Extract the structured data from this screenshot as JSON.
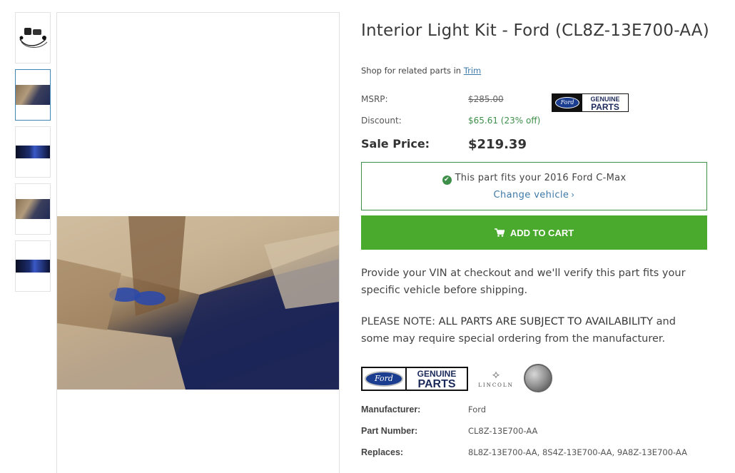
{
  "gallery": {
    "thumbnails": [
      {
        "name": "thumb-light-kit",
        "active": false
      },
      {
        "name": "thumb-interior-day",
        "active": true
      },
      {
        "name": "thumb-interior-night",
        "active": false
      },
      {
        "name": "thumb-interior-day-2",
        "active": false
      },
      {
        "name": "thumb-interior-night-2",
        "active": false
      }
    ]
  },
  "product": {
    "title": "Interior Light Kit - Ford (CL8Z-13E700-AA)",
    "related_prefix": "Shop for related parts in",
    "related_link": "Trim"
  },
  "pricing": {
    "msrp_label": "MSRP:",
    "msrp_value": "$285.00",
    "discount_label": "Discount:",
    "discount_value": "$65.61 (23% off)",
    "sale_label": "Sale Price:",
    "sale_value": "$219.39"
  },
  "badge": {
    "ford": "Ford",
    "genuine": "GENUINE",
    "parts": "PARTS"
  },
  "fitment": {
    "message": "This part fits your 2016 Ford C-Max",
    "change_label": "Change vehicle",
    "check_icon": "check-circle-icon"
  },
  "cart": {
    "label": "ADD TO CART",
    "icon": "cart-icon"
  },
  "notes": {
    "vin_text": "Provide your VIN at checkout and we'll verify this part fits your specific vehicle before shipping.",
    "note_prefix": "PLEASE NOTE:",
    "note_caps": "ALL PARTS ARE SUBJECT TO AVAILABILITY",
    "note_suffix": "and some may require special ordering from the manufacturer."
  },
  "brand_logos": {
    "ford": "Ford",
    "genuine": "GENUINE",
    "parts": "PARTS",
    "lincoln": "LINCOLN"
  },
  "specs": [
    {
      "label": "Manufacturer:",
      "value": "Ford"
    },
    {
      "label": "Part Number:",
      "value": "CL8Z-13E700-AA"
    },
    {
      "label": "Replaces:",
      "value": "8L8Z-13E700-AA, 8S4Z-13E700-AA, 9A8Z-13E700-AA"
    }
  ],
  "colors": {
    "accent_green": "#4aaa2d",
    "link_blue": "#3d7aa8",
    "fit_green": "#3e8f4a"
  }
}
